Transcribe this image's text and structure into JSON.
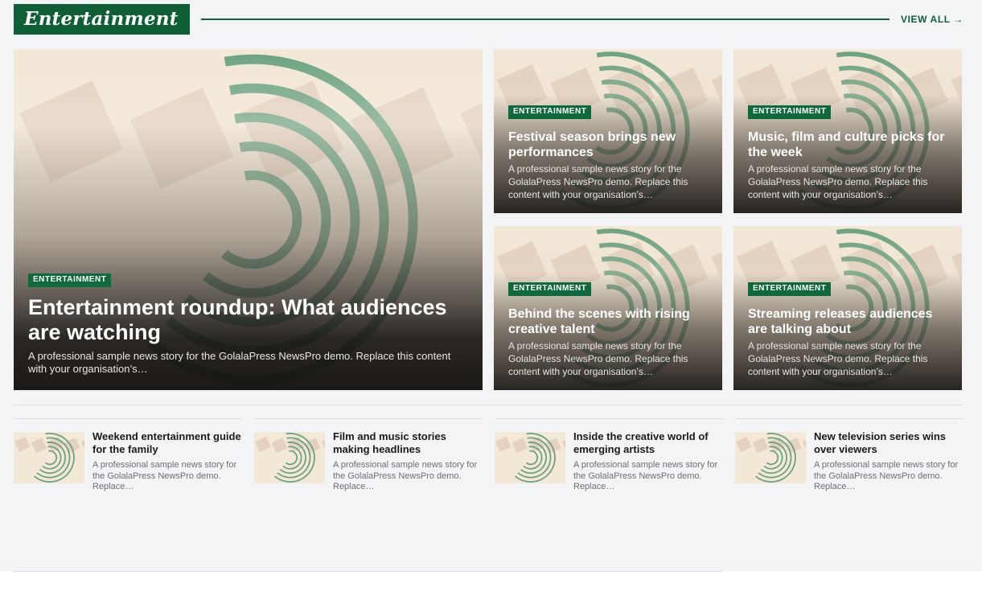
{
  "section": {
    "title": "Entertainment",
    "view_all": "VIEW ALL →"
  },
  "hero": {
    "badge": "ENTERTAINMENT",
    "title": "Entertainment roundup: What audiences are watching",
    "excerpt": "A professional sample news story for the GolalaPress NewsPro demo. Replace this content with your organisation’s…"
  },
  "cards": [
    {
      "badge": "ENTERTAINMENT",
      "title": "Festival season brings new performances",
      "excerpt": "A professional sample news story for the GolalaPress NewsPro demo. Replace this content with your organisation’s…"
    },
    {
      "badge": "ENTERTAINMENT",
      "title": "Music, film and culture picks for the week",
      "excerpt": "A professional sample news story for the GolalaPress NewsPro demo. Replace this content with your organisation’s…"
    },
    {
      "badge": "ENTERTAINMENT",
      "title": "Behind the scenes with rising creative talent",
      "excerpt": "A professional sample news story for the GolalaPress NewsPro demo. Replace this content with your organisation’s…"
    },
    {
      "badge": "ENTERTAINMENT",
      "title": "Streaming releases audiences are talking about",
      "excerpt": "A professional sample news story for the GolalaPress NewsPro demo. Replace this content with your organisation’s…"
    }
  ],
  "list": [
    {
      "title": "Weekend entertainment guide for the family",
      "excerpt": "A professional sample news story for the GolalaPress NewsPro demo. Replace…"
    },
    {
      "title": "Film and music stories making headlines",
      "excerpt": "A professional sample news story for the GolalaPress NewsPro demo. Replace…"
    },
    {
      "title": "Inside the creative world of emerging artists",
      "excerpt": "A professional sample news story for the GolalaPress NewsPro demo. Replace…"
    },
    {
      "title": "New television series wins over viewers",
      "excerpt": "A professional sample news story for the GolalaPress NewsPro demo. Replace…"
    }
  ],
  "colors": {
    "brand_green": "#0e5e36",
    "badge_green": "#0e6a3c",
    "arc_green": "#5a9a78",
    "tile_beige": "#e2cdbb",
    "page_bg": "#f3f4f6"
  },
  "icons": {
    "view_all_arrow": "right-arrow-icon",
    "artwork": "placeholder-arcs-artwork"
  }
}
